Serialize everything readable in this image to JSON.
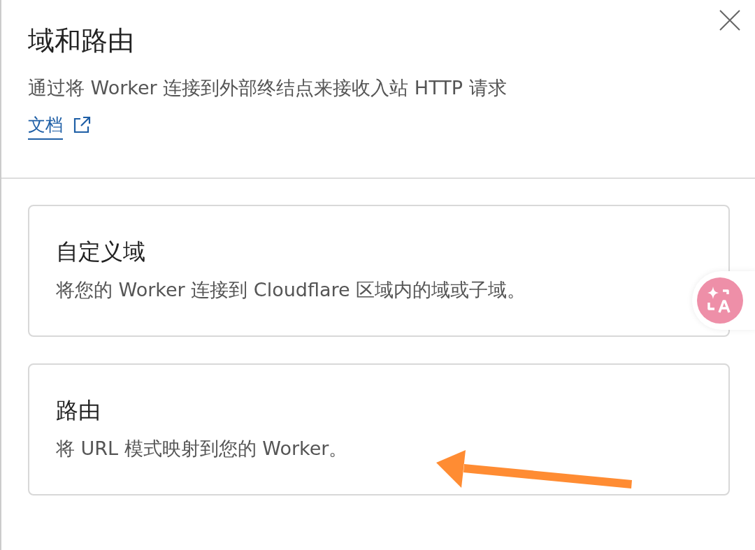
{
  "panel": {
    "title": "域和路由",
    "description": "通过将 Worker 连接到外部终结点来接收入站 HTTP 请求",
    "docs_link": "文档"
  },
  "options": [
    {
      "title": "自定义域",
      "description": "将您的 Worker 连接到 Cloudflare 区域内的域或子域。"
    },
    {
      "title": "路由",
      "description": "将 URL 模式映射到您的 Worker。"
    }
  ]
}
